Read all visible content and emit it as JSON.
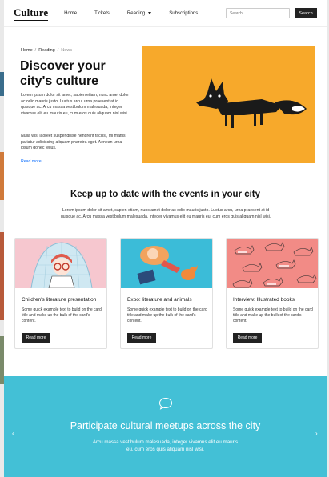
{
  "nav": {
    "brand": "Culture",
    "links": [
      "Home",
      "Tickets",
      "Reading",
      "Subscriptions"
    ],
    "search_placeholder": "Search",
    "search_button": "Search"
  },
  "breadcrumb": [
    "Home",
    "Reading",
    "News"
  ],
  "hero": {
    "title": "Discover your city's culture",
    "p1": "Lorem ipsum dolor sit amet, sapien etiam, nunc amet dolor ac odio mauris justo. Luctus arcu, urna praesent at id quisque ac. Arcu massa vestibulum malesuada, integer vivamus elit eu mauris eu, cum eros quis aliquam nisl wisi.",
    "p2": "Nulla wisi laoreet suspendisse hendrerit facilisi, mi mattis pariatur adipiscing aliquam pharetra eget. Aenean urna ipsum donec tellus.",
    "read_more": "Read more"
  },
  "section": {
    "title": "Keep up to date with the events in your city",
    "text": "Lorem ipsum dolor sit amet, sapien etiam, nunc amet dolor ac odio mauris justo. Luctus arcu, urna praesent at id quisque ac. Arcu massa vestibulum malesuada, integer vivamus elit eu mauris eu, cum eros quis aliquam nisl wisi."
  },
  "cards": [
    {
      "title": "Children's literature presentation",
      "text": "Some quick example text to build on the card title and make up the bulk of the card's content.",
      "button": "Read more"
    },
    {
      "title": "Expo: literature and animals",
      "text": "Some quick example text to build on the card title and make up the bulk of the card's content.",
      "button": "Read more"
    },
    {
      "title": "Interview: Illustrated books",
      "text": "Some quick example text to build on the card title and make up the bulk of the card's content.",
      "button": "Read more"
    }
  ],
  "banner": {
    "title": "Participate cultural meetups across the city",
    "text": "Arcu massa vestibulum malesuada, integer vivamus elit eu mauris eu, cum eros quis aliquam nisl wisi.",
    "prev": "‹",
    "next": "›"
  },
  "colors": {
    "accent": "#43c0d6",
    "hero_bg": "#f7a92b",
    "button": "#222222",
    "link": "#0d6efd"
  }
}
